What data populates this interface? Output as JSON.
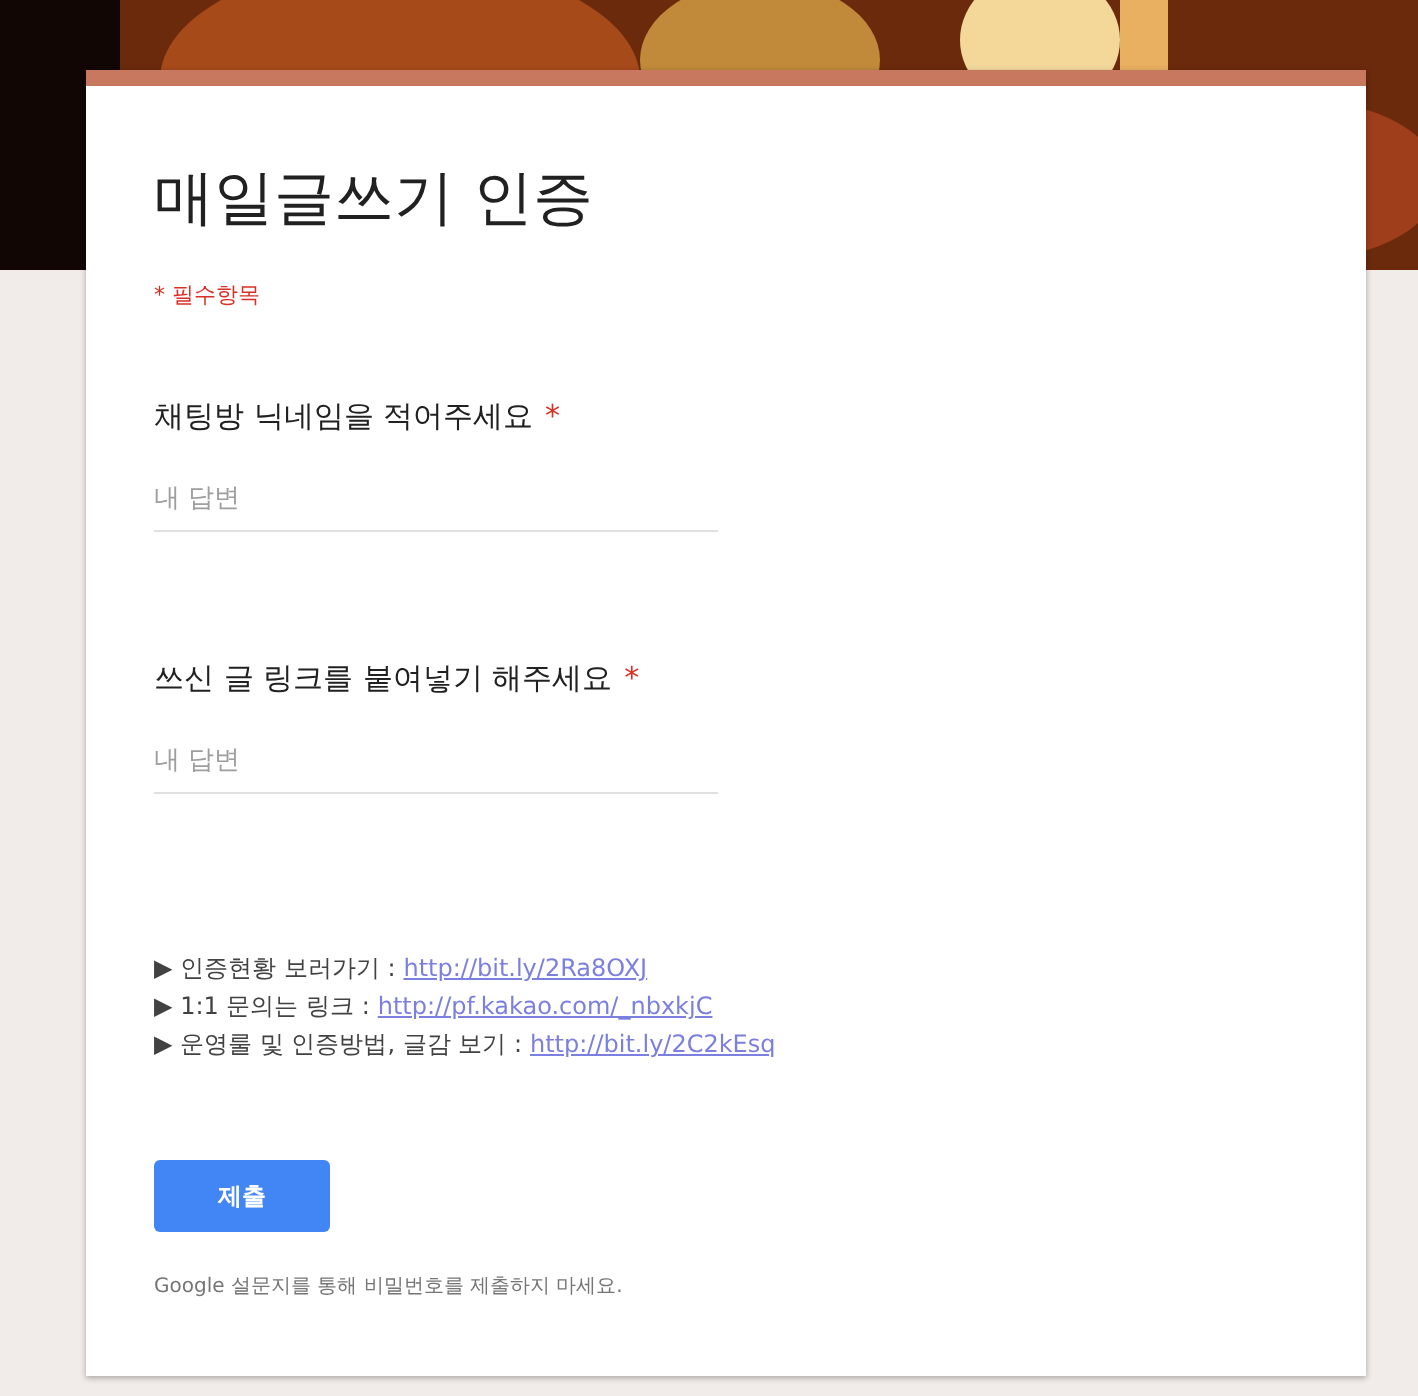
{
  "form": {
    "title": "매일글쓰기 인증",
    "required_note": "* 필수항목",
    "questions": [
      {
        "label": "채팅방 닉네임을 적어주세요",
        "required_mark": "*",
        "placeholder": "내 답변"
      },
      {
        "label": "쓰신 글 링크를 붙여넣기 해주세요",
        "required_mark": "*",
        "placeholder": "내 답변"
      }
    ],
    "info_lines": [
      {
        "marker": "▶",
        "text": "인증현황 보러가기 :",
        "link": "http://bit.ly/2Ra8OXJ"
      },
      {
        "marker": "▶",
        "text": "1:1 문의는 링크 :",
        "link": "http://pf.kakao.com/_nbxkjC"
      },
      {
        "marker": "▶",
        "text": "운영룰 및 인증방법, 글감 보기 :",
        "link": "http://bit.ly/2C2kEsq"
      }
    ],
    "submit": "제출",
    "footer": "Google 설문지를 통해 비밀번호를 제출하지 마세요."
  }
}
